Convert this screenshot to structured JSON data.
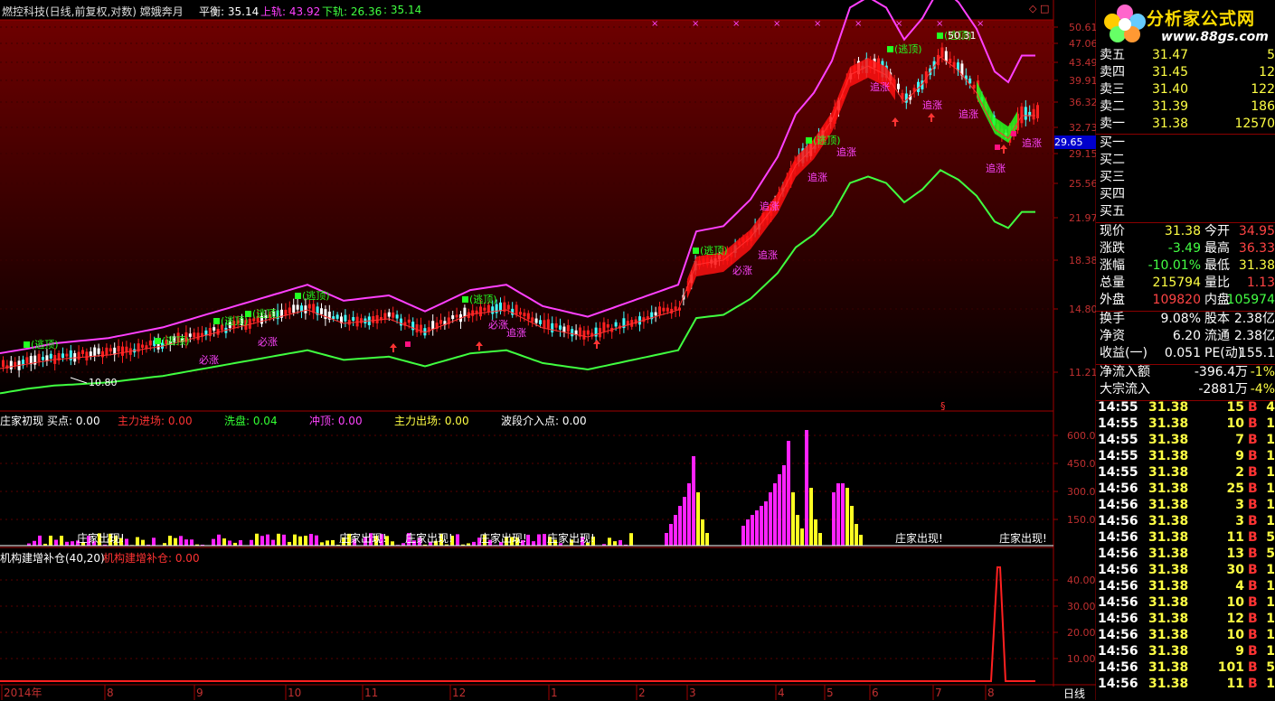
{
  "header": {
    "title": "燃控科技(日线,前复权,对数) 嫦娥奔月",
    "fields": [
      {
        "label": "平衡:",
        "value": "35.14",
        "color": "#ffffff"
      },
      {
        "label": "上轨:",
        "value": "43.92",
        "color": "#ff40ff"
      },
      {
        "label": "下轨:",
        "value": "26.36",
        "color": "#40ff40"
      },
      {
        "label": ":",
        "value": "35.14",
        "color": "#40ff40"
      }
    ]
  },
  "price_axis": [
    "50.61",
    "47.06",
    "43.49",
    "39.91",
    "36.32",
    "32.73",
    "29.15",
    "25.56",
    "21.97",
    "18.38",
    "14.80",
    "11.21"
  ],
  "current_price_tag": "29.65",
  "low_label": "10.80",
  "high_label": "50.31",
  "annotations": {
    "zhui_zhang": "追涨",
    "tao_ding": "逃顶",
    "bi_zhang": "必涨",
    "wave_start": "波段介入点"
  },
  "indicator1": {
    "legend": [
      {
        "text": "庄家初现",
        "color": "#ffffff"
      },
      {
        "text": "买点: 0.00",
        "color": "#ffffff"
      },
      {
        "text": "主力进场: 0.00",
        "color": "#ff3333"
      },
      {
        "text": "洗盘: 0.04",
        "color": "#33ff33"
      },
      {
        "text": "冲顶: 0.00",
        "color": "#ff44ff"
      },
      {
        "text": "主力出场: 0.00",
        "color": "#ffff44"
      },
      {
        "text": "波段介入点: 0.00",
        "color": "#ffffff"
      }
    ],
    "axis": [
      "600.0",
      "450.0",
      "300.0",
      "150.0"
    ],
    "tag": "庄家出现!"
  },
  "indicator2": {
    "legend": [
      {
        "text": "机构建增补仓(40,20)",
        "color": "#ffffff"
      },
      {
        "text": "机构建增补仓: 0.00",
        "color": "#ff3333"
      }
    ],
    "axis": [
      "40.00",
      "30.00",
      "20.00",
      "10.00"
    ]
  },
  "time_axis": {
    "labels": [
      "2014年",
      "8",
      "9",
      "10",
      "11",
      "12",
      "1",
      "2",
      "3",
      "4",
      "5",
      "6",
      "7",
      "8"
    ],
    "period": "日线"
  },
  "logo": {
    "name": "分析家公式网",
    "url": "www.88gs.com"
  },
  "quotes": {
    "sell": [
      {
        "label": "卖五",
        "price": "31.47",
        "vol": "5"
      },
      {
        "label": "卖四",
        "price": "31.45",
        "vol": "12"
      },
      {
        "label": "卖三",
        "price": "31.40",
        "vol": "122"
      },
      {
        "label": "卖二",
        "price": "31.39",
        "vol": "186"
      },
      {
        "label": "卖一",
        "price": "31.38",
        "vol": "12570"
      }
    ],
    "buy": [
      {
        "label": "买一"
      },
      {
        "label": "买二"
      },
      {
        "label": "买三"
      },
      {
        "label": "买四"
      },
      {
        "label": "买五"
      }
    ],
    "stats": [
      {
        "l1": "现价",
        "v1": "31.38",
        "c1": "#ffff44",
        "l2": "今开",
        "v2": "34.95",
        "c2": "#ff4444"
      },
      {
        "l1": "涨跌",
        "v1": "-3.49",
        "c1": "#44ff44",
        "l2": "最高",
        "v2": "36.33",
        "c2": "#ff4444"
      },
      {
        "l1": "涨幅",
        "v1": "-10.01%",
        "c1": "#44ff44",
        "l2": "最低",
        "v2": "31.38",
        "c2": "#ffff44"
      },
      {
        "l1": "总量",
        "v1": "215794",
        "c1": "#ffff44",
        "l2": "量比",
        "v2": "1.13",
        "c2": "#ff4444"
      },
      {
        "l1": "外盘",
        "v1": "109820",
        "c1": "#ff4444",
        "l2": "内盘",
        "v2": "105974",
        "c2": "#44ff44"
      }
    ],
    "finance": [
      {
        "l1": "换手",
        "v1": "9.08%",
        "l2": "股本",
        "v2": "2.38亿"
      },
      {
        "l1": "净资",
        "v1": "6.20",
        "l2": "流通",
        "v2": "2.38亿"
      },
      {
        "l1": "收益(一)",
        "v1": "0.051",
        "l2": "PE(动)",
        "v2": "155.1"
      }
    ],
    "flow": [
      {
        "label": "净流入额",
        "value": "-396.4万",
        "pct": "-1%"
      },
      {
        "label": "大宗流入",
        "value": "-2881万",
        "pct": "-4%"
      }
    ],
    "ticks": [
      {
        "t": "14:55",
        "p": "31.38",
        "v": "15",
        "s": "B",
        "n": "4"
      },
      {
        "t": "14:55",
        "p": "31.38",
        "v": "10",
        "s": "B",
        "n": "1"
      },
      {
        "t": "14:55",
        "p": "31.38",
        "v": "7",
        "s": "B",
        "n": "1"
      },
      {
        "t": "14:55",
        "p": "31.38",
        "v": "9",
        "s": "B",
        "n": "1"
      },
      {
        "t": "14:55",
        "p": "31.38",
        "v": "2",
        "s": "B",
        "n": "1"
      },
      {
        "t": "14:56",
        "p": "31.38",
        "v": "25",
        "s": "B",
        "n": "1"
      },
      {
        "t": "14:56",
        "p": "31.38",
        "v": "3",
        "s": "B",
        "n": "1"
      },
      {
        "t": "14:56",
        "p": "31.38",
        "v": "3",
        "s": "B",
        "n": "1"
      },
      {
        "t": "14:56",
        "p": "31.38",
        "v": "11",
        "s": "B",
        "n": "5"
      },
      {
        "t": "14:56",
        "p": "31.38",
        "v": "13",
        "s": "B",
        "n": "5"
      },
      {
        "t": "14:56",
        "p": "31.38",
        "v": "30",
        "s": "B",
        "n": "1"
      },
      {
        "t": "14:56",
        "p": "31.38",
        "v": "4",
        "s": "B",
        "n": "1"
      },
      {
        "t": "14:56",
        "p": "31.38",
        "v": "10",
        "s": "B",
        "n": "1"
      },
      {
        "t": "14:56",
        "p": "31.38",
        "v": "12",
        "s": "B",
        "n": "1"
      },
      {
        "t": "14:56",
        "p": "31.38",
        "v": "10",
        "s": "B",
        "n": "1"
      },
      {
        "t": "14:56",
        "p": "31.38",
        "v": "9",
        "s": "B",
        "n": "1"
      },
      {
        "t": "14:56",
        "p": "31.38",
        "v": "101",
        "s": "B",
        "n": "5"
      },
      {
        "t": "14:56",
        "p": "31.38",
        "v": "11",
        "s": "B",
        "n": "1"
      }
    ]
  },
  "colors": {
    "bg_top": "#6e0000",
    "up": "#ff2020",
    "down": "#40ffff",
    "upper_band": "#ff40ff",
    "lower_band": "#40ff40",
    "axis": "#a00000"
  }
}
